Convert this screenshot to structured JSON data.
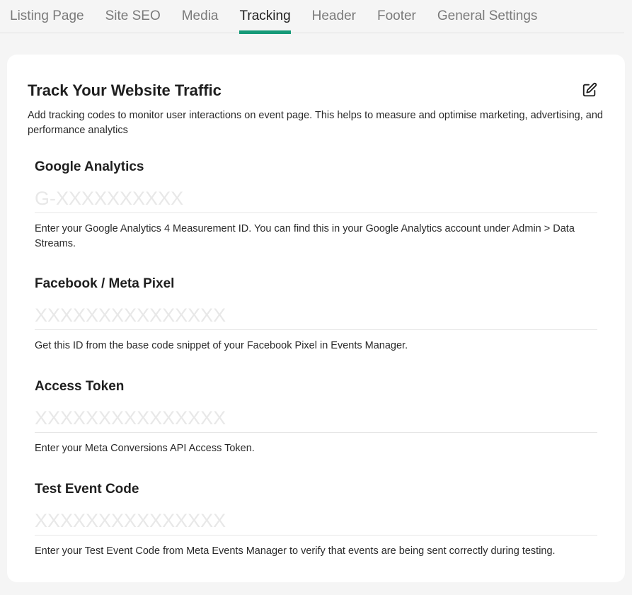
{
  "tabs": [
    {
      "label": "Listing Page"
    },
    {
      "label": "Site SEO"
    },
    {
      "label": "Media"
    },
    {
      "label": "Tracking"
    },
    {
      "label": "Header"
    },
    {
      "label": "Footer"
    },
    {
      "label": "General Settings"
    }
  ],
  "active_tab": "Tracking",
  "accent_color": "#159a78",
  "card": {
    "title": "Track Your Website Traffic",
    "description": "Add tracking codes to monitor user interactions on event page. This helps to measure and optimise marketing, advertising, and performance analytics",
    "edit_icon": "edit-icon"
  },
  "fields": [
    {
      "label": "Google Analytics",
      "value": "",
      "placeholder": "G-XXXXXXXXXX",
      "help": "Enter your Google Analytics 4 Measurement ID. You can find this in your Google Analytics account under Admin > Data Streams."
    },
    {
      "label": "Facebook / Meta Pixel",
      "value": "",
      "placeholder": "XXXXXXXXXXXXXXX",
      "help": "Get this ID from the base code snippet of your Facebook Pixel in Events Manager."
    },
    {
      "label": "Access Token",
      "value": "",
      "placeholder": "XXXXXXXXXXXXXXX",
      "help": "Enter your Meta Conversions API Access Token."
    },
    {
      "label": "Test Event Code",
      "value": "",
      "placeholder": "XXXXXXXXXXXXXXX",
      "help": "Enter your Test Event Code from Meta Events Manager to verify that events are being sent correctly during testing."
    }
  ]
}
